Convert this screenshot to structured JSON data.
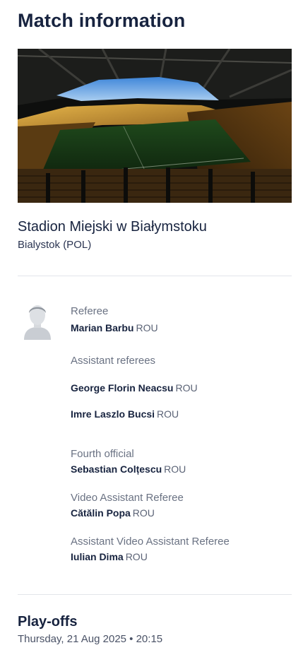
{
  "page_title": "Match information",
  "venue": {
    "image_icon": "stadium-photo",
    "name": "Stadion Miejski w Białymstoku",
    "city": "Bialystok (POL)"
  },
  "officials": {
    "avatar_icon": "person-placeholder-icon",
    "referee": {
      "role": "Referee",
      "name": "Marian Barbu",
      "country": "ROU"
    },
    "assistants": {
      "role": "Assistant referees",
      "people": [
        {
          "name": "George Florin Neacsu",
          "country": "ROU"
        },
        {
          "name": "Imre Laszlo Bucsi",
          "country": "ROU"
        }
      ]
    },
    "fourth": {
      "role": "Fourth official",
      "name": "Sebastian Colțescu",
      "country": "ROU"
    },
    "var": {
      "role": "Video Assistant Referee",
      "name": "Cătălin Popa",
      "country": "ROU"
    },
    "avar": {
      "role": "Assistant Video Assistant Referee",
      "name": "Iulian Dima",
      "country": "ROU"
    }
  },
  "match": {
    "round": "Play-offs",
    "datetime": "Thursday, 21 Aug 2025 • 20:15"
  }
}
